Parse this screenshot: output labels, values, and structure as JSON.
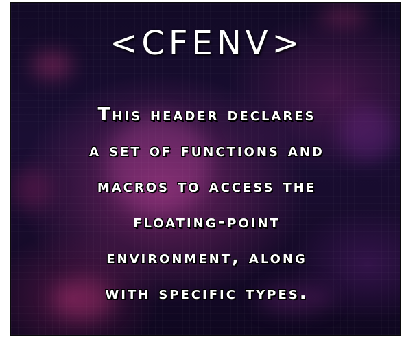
{
  "title": "<CFENV>",
  "description_lines": [
    "This header declares",
    "a set of functions and",
    "macros to access the",
    "floating-point",
    "environment, along",
    "with specific types."
  ],
  "colors": {
    "background_dark": "#140b2b",
    "glow_pink": "#c83c96",
    "text": "#ffffff",
    "border": "#0b0b0b"
  }
}
